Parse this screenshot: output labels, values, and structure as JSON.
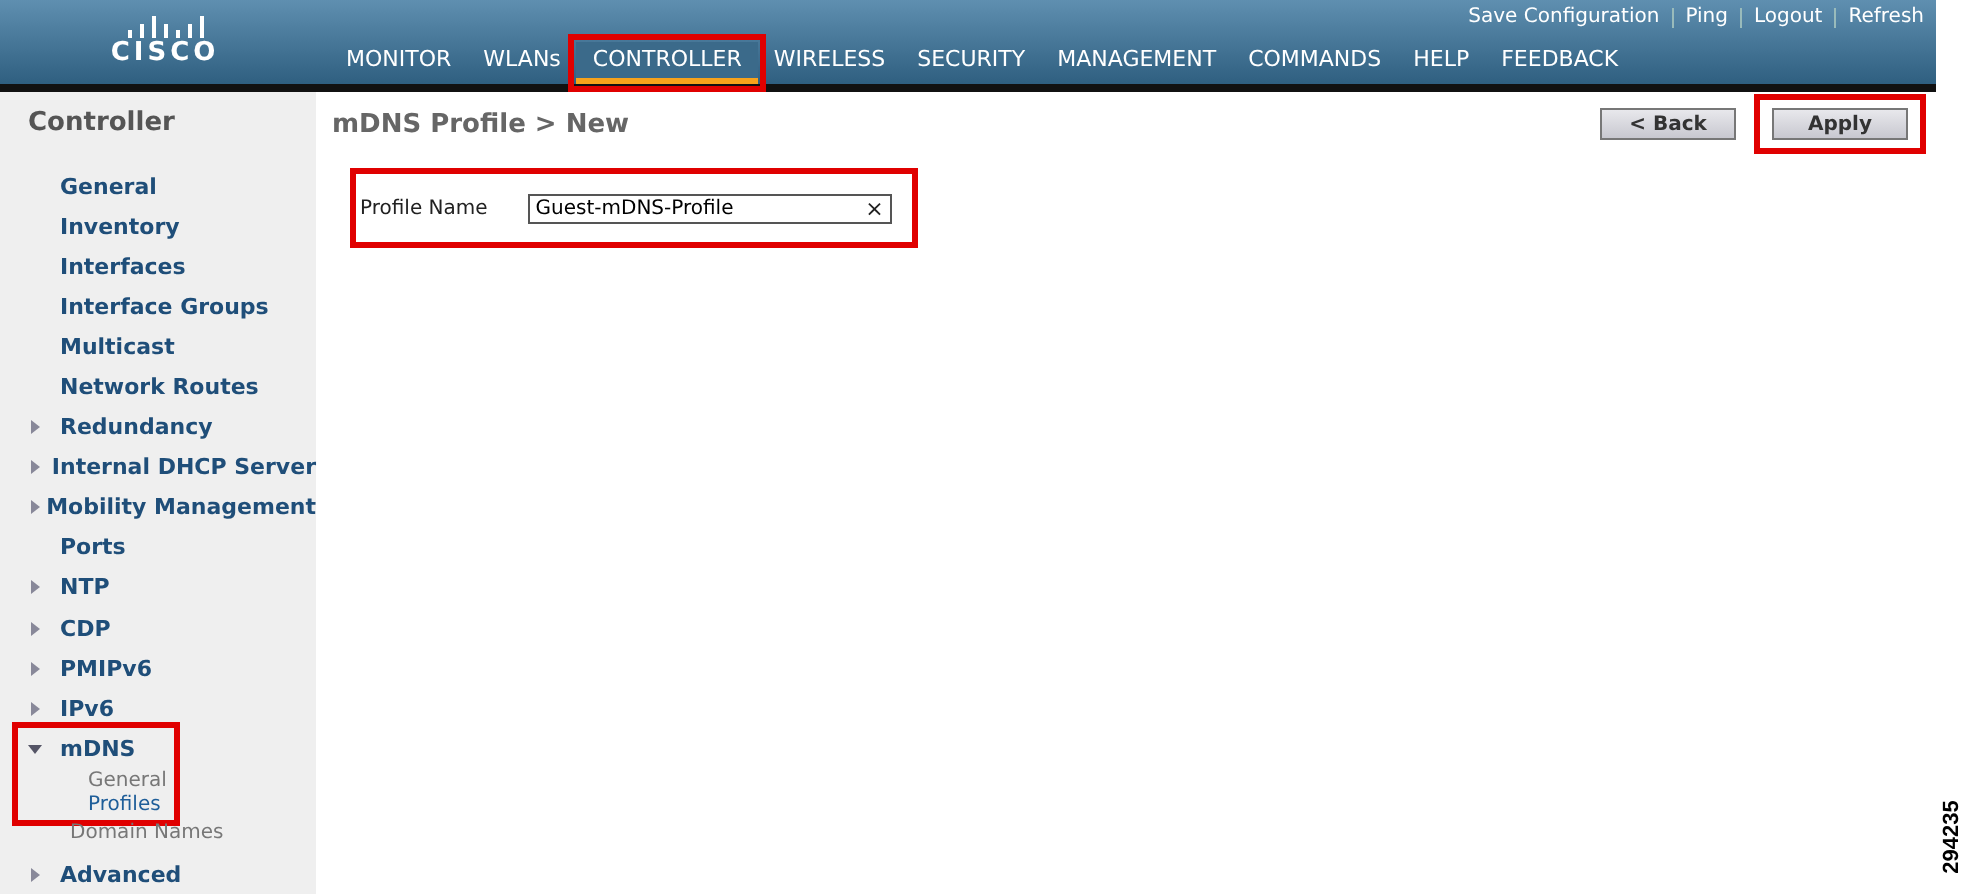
{
  "header": {
    "logo": "CISCO",
    "links": [
      "Save Configuration",
      "Ping",
      "Logout",
      "Refresh"
    ],
    "nav": [
      {
        "label": "MONITOR",
        "selected": false,
        "highlighted": false
      },
      {
        "label": "WLANs",
        "selected": false,
        "highlighted": false
      },
      {
        "label": "CONTROLLER",
        "selected": true,
        "highlighted": true
      },
      {
        "label": "WIRELESS",
        "selected": false,
        "highlighted": false
      },
      {
        "label": "SECURITY",
        "selected": false,
        "highlighted": false
      },
      {
        "label": "MANAGEMENT",
        "selected": false,
        "highlighted": false
      },
      {
        "label": "COMMANDS",
        "selected": false,
        "highlighted": false
      },
      {
        "label": "HELP",
        "selected": false,
        "highlighted": false
      },
      {
        "label": "FEEDBACK",
        "selected": false,
        "highlighted": false
      }
    ]
  },
  "sidebar": {
    "title": "Controller",
    "items": [
      {
        "label": "General",
        "kind": "plain"
      },
      {
        "label": "Inventory",
        "kind": "plain"
      },
      {
        "label": "Interfaces",
        "kind": "plain"
      },
      {
        "label": "Interface Groups",
        "kind": "plain"
      },
      {
        "label": "Multicast",
        "kind": "plain"
      },
      {
        "label": "Network Routes",
        "kind": "plain"
      },
      {
        "label": "Redundancy",
        "kind": "group",
        "expanded": false
      },
      {
        "label": "Internal DHCP Server",
        "kind": "group",
        "expanded": false
      },
      {
        "label": "Mobility Management",
        "kind": "group",
        "expanded": false
      },
      {
        "label": "Ports",
        "kind": "plain"
      },
      {
        "label": "NTP",
        "kind": "group",
        "expanded": false
      },
      {
        "label": "CDP",
        "kind": "group",
        "expanded": false
      },
      {
        "label": "PMIPv6",
        "kind": "group",
        "expanded": false
      },
      {
        "label": "IPv6",
        "kind": "group",
        "expanded": false
      },
      {
        "label": "mDNS",
        "kind": "group",
        "expanded": true,
        "highlighted": true,
        "children": [
          {
            "label": "General",
            "selected": false
          },
          {
            "label": "Profiles",
            "selected": true
          },
          {
            "label": "Domain Names",
            "selected": false
          }
        ]
      },
      {
        "label": "Advanced",
        "kind": "group",
        "expanded": false
      }
    ]
  },
  "page": {
    "title": "mDNS Profile > New",
    "buttons": [
      {
        "label": "< Back",
        "highlighted": false
      },
      {
        "label": "Apply",
        "highlighted": true
      }
    ],
    "form": {
      "label": "Profile Name",
      "value": "Guest-mDNS-Profile",
      "clear": "×",
      "highlighted": true
    }
  },
  "figure_number": "294235"
}
